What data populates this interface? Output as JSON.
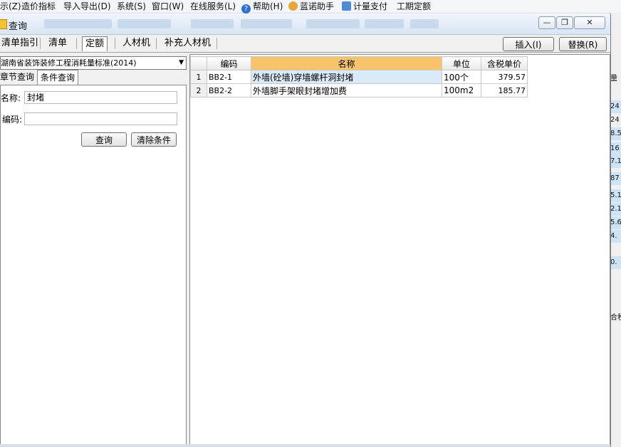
{
  "menubar": {
    "items": [
      "示(Z)",
      "造价指标",
      "导入导出(D)",
      "系统(S)",
      "窗口(W)",
      "在线服务(L)",
      "帮助(H)",
      "蓝诺助手",
      "计量支付",
      "工期定额"
    ]
  },
  "dialog": {
    "title": "查询",
    "window_buttons": {
      "minimize": "—",
      "restore": "❐",
      "close": "✕"
    },
    "top_tabs": [
      "清单指引",
      "清单",
      "定额",
      "人材机",
      "补充人材机"
    ],
    "insert_button": "插入(I)",
    "replace_button": "替换(R)"
  },
  "left": {
    "standard_select": "湖南省装饰装修工程消耗量标准(2014)",
    "subtabs": [
      "章节查询",
      "条件查询"
    ],
    "name_label": "名称:",
    "name_value": "封堵",
    "code_label": "编码:",
    "code_value": "",
    "query_button": "查询",
    "clear_button": "清除条件"
  },
  "grid": {
    "columns": [
      "编码",
      "名称",
      "单位",
      "含税单价"
    ],
    "rows": [
      {
        "index": "1",
        "code": "BB2-1",
        "name": "外墙(砼墙)穿墙螺杆洞封堵",
        "unit": "100个",
        "price": "379.57"
      },
      {
        "index": "2",
        "code": "BB2-2",
        "name": "外墙脚手架眼封堵增加费",
        "unit": "100m2",
        "price": "185.77"
      }
    ]
  },
  "background_app": {
    "fragments": [
      "量",
      "24",
      "24",
      "8.5",
      "16",
      "7.1",
      "87",
      "5.1",
      "2.1",
      "5.6",
      "4.",
      "0.",
      "合税"
    ]
  },
  "colors": {
    "active_column_header": "#f7c46c",
    "selected_cell": "#dbeaf9",
    "title_bar": "#d9e5f3"
  }
}
